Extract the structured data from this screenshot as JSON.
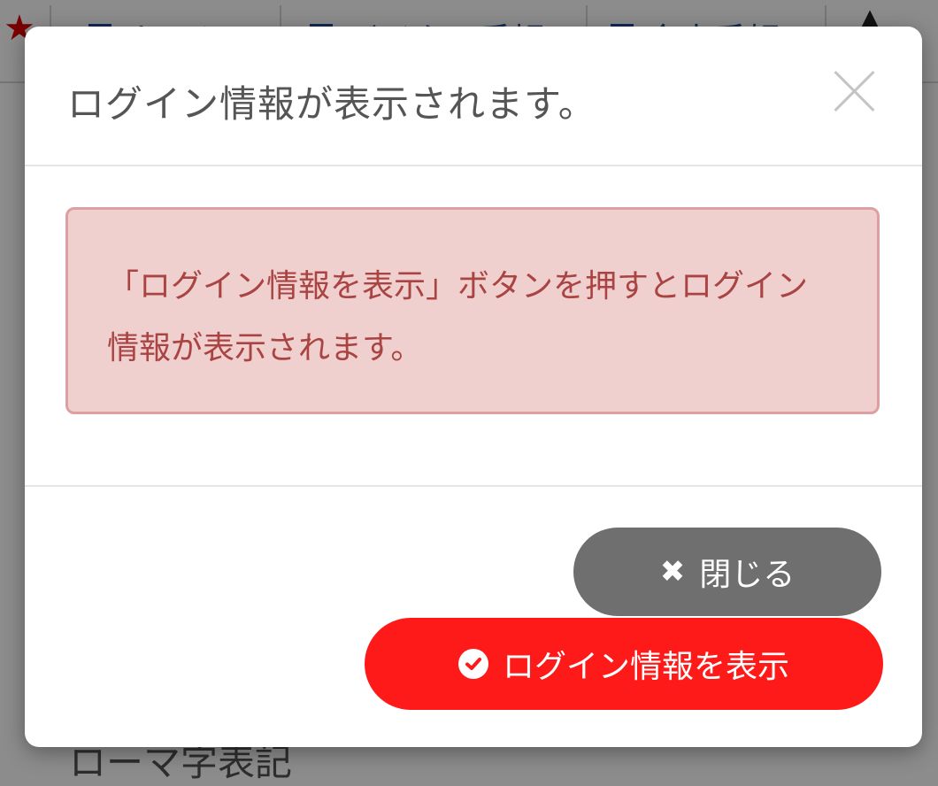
{
  "background": {
    "nav_items": [
      {
        "label": "ホーム"
      },
      {
        "label": "バイクル手帳"
      },
      {
        "label": "企事手帳"
      }
    ],
    "romaji_label": "ローマ字表記"
  },
  "modal": {
    "title": "ログイン情報が表示されます。",
    "close_icon": "close-icon",
    "alert": {
      "text": "「ログイン情報を表示」ボタンを押すとログイン情報が表示されます。",
      "background_color": "#f0cfcf",
      "text_color": "#a94442"
    },
    "buttons": {
      "close_label": "閉じる",
      "close_icon": "times-icon",
      "close_color": "#6f6f6f",
      "show_label": "ログイン情報を表示",
      "show_icon": "check-circle-icon",
      "show_color": "#ff1a1a"
    }
  }
}
